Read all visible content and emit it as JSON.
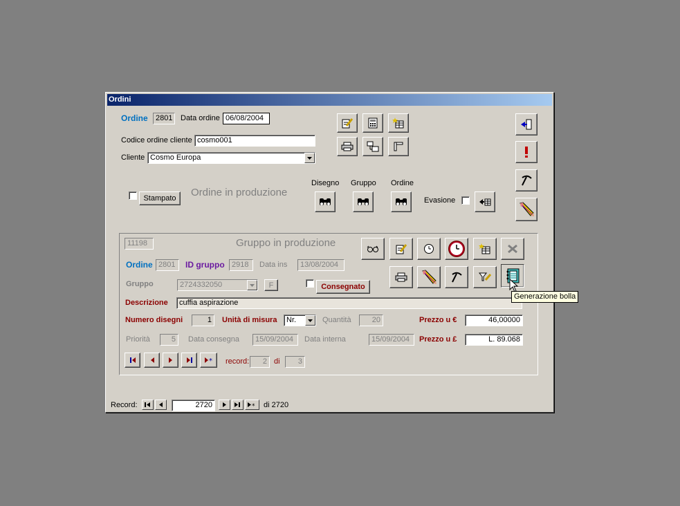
{
  "window": {
    "title": "Ordini"
  },
  "header": {
    "ordine_label": "Ordine",
    "ordine_value": "2801",
    "data_ordine_label": "Data ordine",
    "data_ordine_value": "06/08/2004",
    "codice_label": "Codice ordine cliente",
    "codice_value": "cosmo001",
    "cliente_label": "Cliente",
    "cliente_value": "Cosmo Europa",
    "stampato_label": "Stampato",
    "status_text": "Ordine in produzione",
    "disegno_label": "Disegno",
    "gruppo_label": "Gruppo",
    "ordine_search_label": "Ordine",
    "evasione_label": "Evasione"
  },
  "group": {
    "id_value": "11198",
    "status_text": "Gruppo in produzione",
    "ordine_label": "Ordine",
    "ordine_value": "2801",
    "id_gruppo_label": "ID gruppo",
    "id_gruppo_value": "2918",
    "data_ins_label": "Data ins",
    "data_ins_value": "13/08/2004",
    "gruppo_label": "Gruppo",
    "gruppo_value": "2724332050",
    "f_value": "F",
    "consegnato_label": "Consegnato",
    "descrizione_label": "Descrizione",
    "descrizione_value": "cuffia aspirazione",
    "numero_disegni_label": "Numero disegni",
    "numero_disegni_value": "1",
    "unita_label": "Unità di misura",
    "unita_value": "Nr.",
    "quantita_label": "Quantità",
    "quantita_value": "20",
    "prezzo_euro_label": "Prezzo u €",
    "prezzo_euro_value": "46,00000",
    "priorita_label": "Priorità",
    "priorita_value": "5",
    "data_consegna_label": "Data consegna",
    "data_consegna_value": "15/09/2004",
    "data_interna_label": "Data interna",
    "data_interna_value": "15/09/2004",
    "prezzo_lire_label": "Prezzo u £",
    "prezzo_lire_value": "L. 89.068",
    "record_label": "record:",
    "record_value": "2",
    "di_label": "di",
    "di_value": "3"
  },
  "tooltip": "Generazione bolla",
  "footer": {
    "record_label": "Record:",
    "record_value": "2720",
    "total_label": "di 2720"
  },
  "colors": {
    "title_start": "#0a246a",
    "title_end": "#a6caf0",
    "face": "#d4d0c8",
    "blue_label": "#0070c0",
    "red_label": "#8b0000"
  }
}
